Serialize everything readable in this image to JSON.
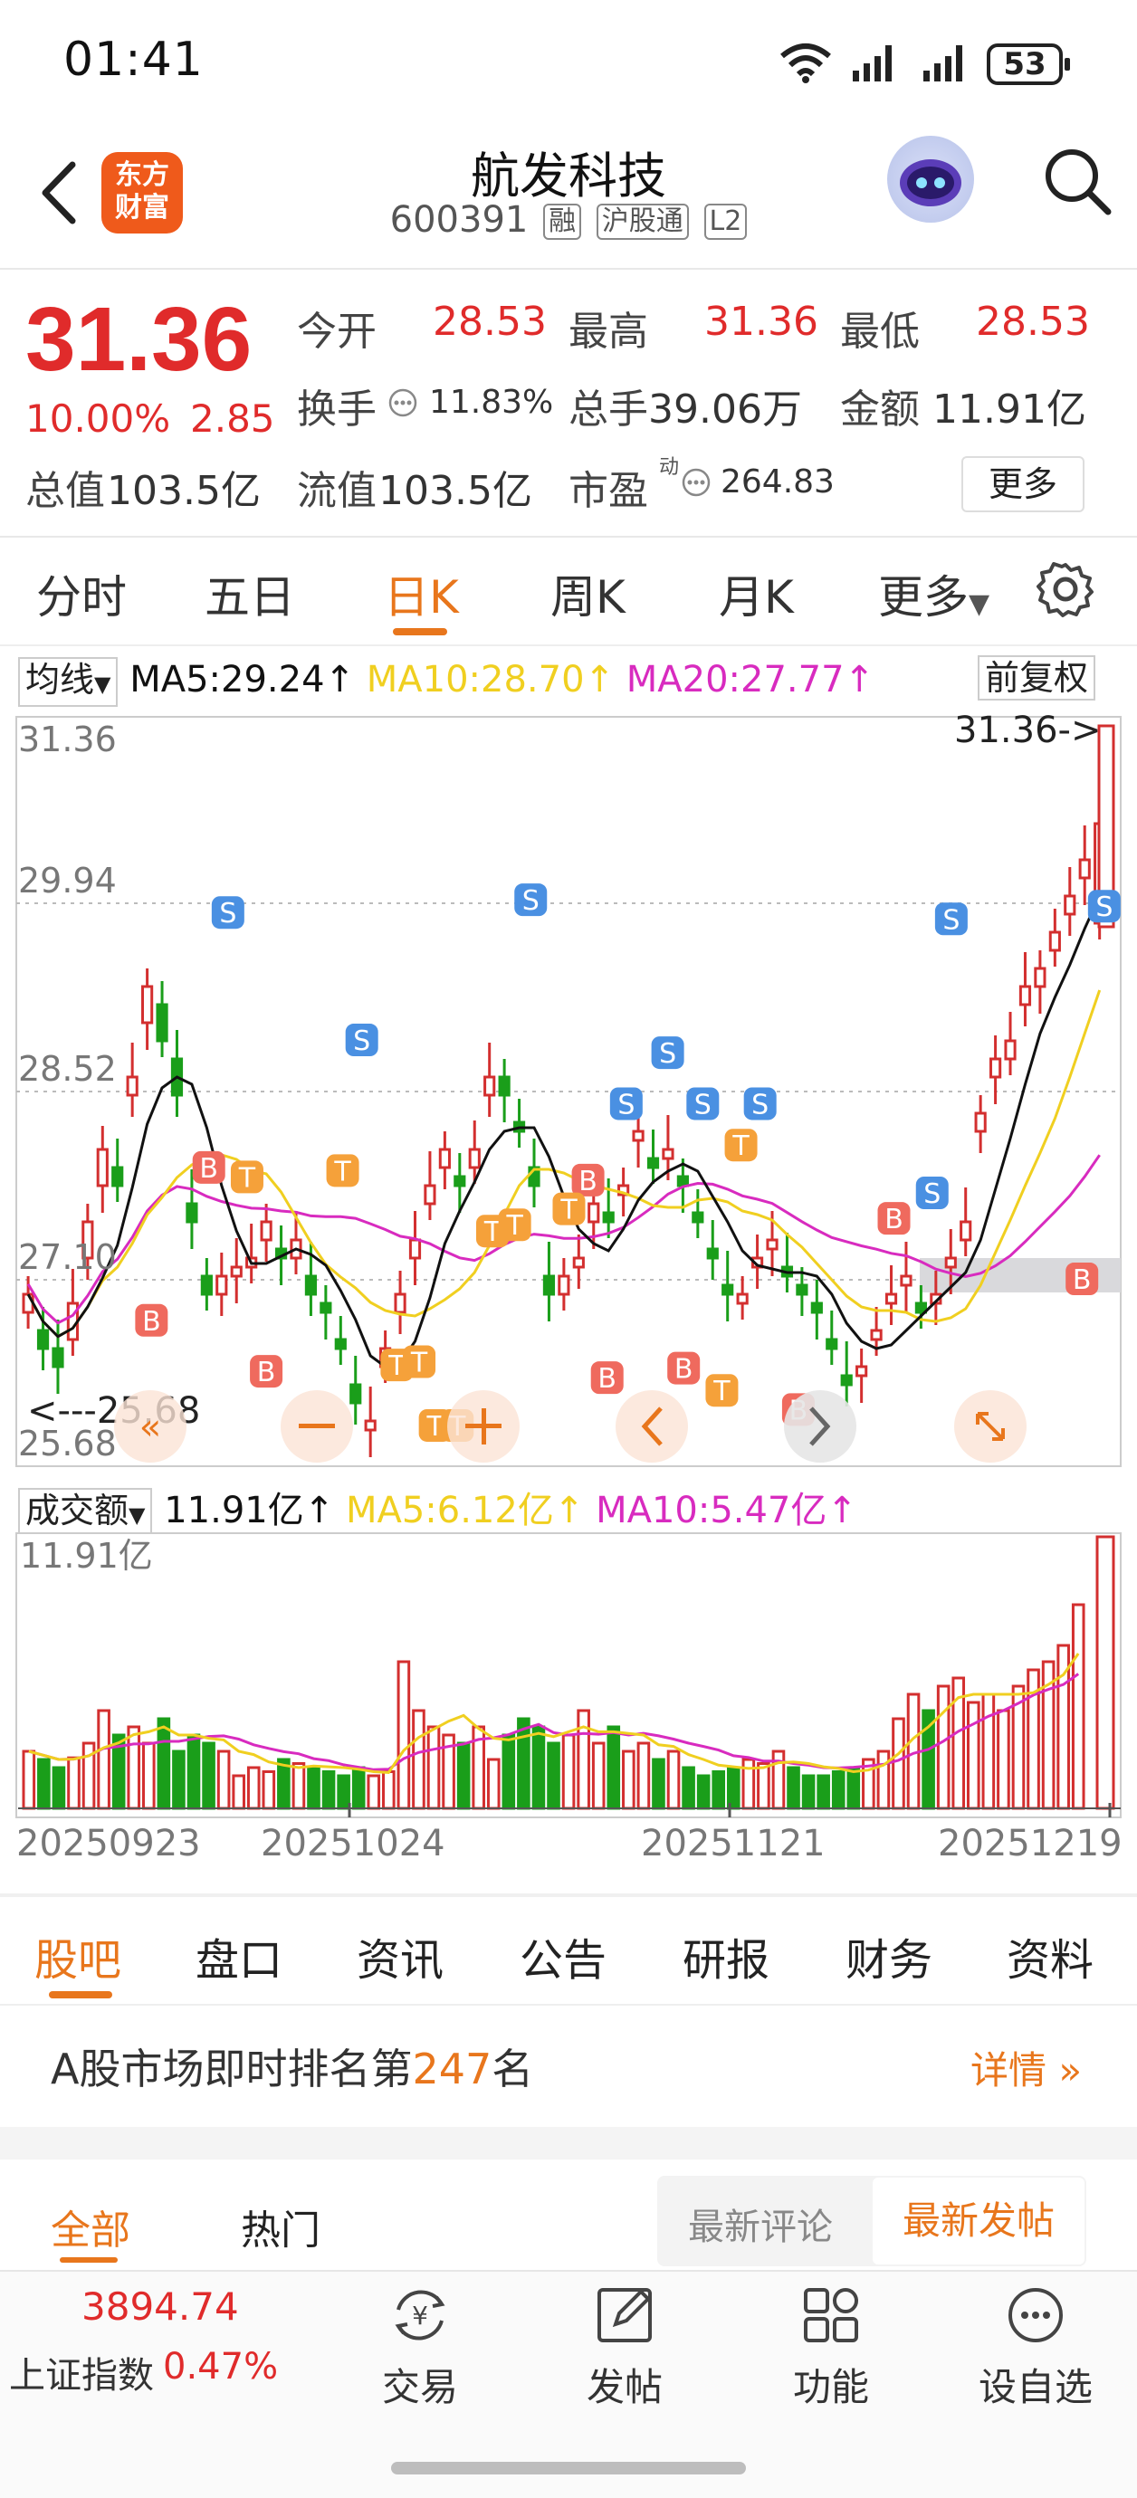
{
  "status_bar": {
    "time": "01:41",
    "battery": "53"
  },
  "header": {
    "logo_line1": "东方",
    "logo_line2": "财富",
    "stock_name": "航发科技",
    "stock_code": "600391",
    "tags": [
      "融",
      "沪股通",
      "L2"
    ]
  },
  "quote": {
    "price": "31.36",
    "change_pct": "10.00%",
    "change": "2.85",
    "open_label": "今开",
    "open": "28.53",
    "high_label": "最高",
    "high": "31.36",
    "low_label": "最低",
    "low": "28.53",
    "turnover_label": "换手",
    "turnover": "11.83%",
    "volume_label": "总手",
    "volume": "39.06万",
    "amount_label": "金额",
    "amount": "11.91亿",
    "mktcap_label": "总值",
    "mktcap": "103.5亿",
    "float_label": "流值",
    "float_cap": "103.5亿",
    "pe_label": "市盈",
    "pe_sup": "动",
    "pe": "264.83",
    "more_label": "更多"
  },
  "period_tabs": [
    "分时",
    "五日",
    "日K",
    "周K",
    "月K",
    "更多"
  ],
  "ma_row": {
    "selector": "均线",
    "ma5": "MA5:29.24↑",
    "ma10": "MA10:28.70↑",
    "ma20": "MA20:27.77↑",
    "fuquan": "前复权"
  },
  "kline": {
    "y_labels": [
      "31.36",
      "29.94",
      "28.52",
      "27.10",
      "25.68"
    ],
    "last_price_marker": "31.36->",
    "low_marker": "<---25.68"
  },
  "volume_row": {
    "selector": "成交额",
    "amount": "11.91亿↑",
    "ma5": "MA5:6.12亿↑",
    "ma10": "MA10:5.47亿↑",
    "y_max": "11.91亿"
  },
  "dates": [
    "20250923",
    "20251024",
    "20251121",
    "20251219"
  ],
  "colors": {
    "up": "#d32f2f",
    "down": "#1a9e1a",
    "accent": "#e8761c",
    "ma5": "#111111",
    "ma10": "#f0cf20",
    "ma20": "#d82bbf"
  },
  "bottom_tabs": [
    "股吧",
    "盘口",
    "资讯",
    "公告",
    "研报",
    "财务",
    "资料"
  ],
  "rank": {
    "prefix": "A股市场即时排名第",
    "rank": "247",
    "suffix": "名",
    "detail": "详情"
  },
  "sub_tabs": {
    "all": "全部",
    "hot": "热门",
    "latest_comment": "最新评论",
    "latest_post": "最新发帖"
  },
  "bottom_nav": {
    "index_value": "3894.74",
    "index_name": "上证指数",
    "index_pct": "0.47%",
    "items": [
      "交易",
      "发帖",
      "功能",
      "设自选"
    ]
  },
  "chart_data": {
    "type": "candlestick",
    "ylim": [
      25.68,
      31.36
    ],
    "dates_shown": [
      "20250923",
      "20251024",
      "20251121",
      "20251219"
    ],
    "last": 31.36,
    "low": 25.68
  }
}
